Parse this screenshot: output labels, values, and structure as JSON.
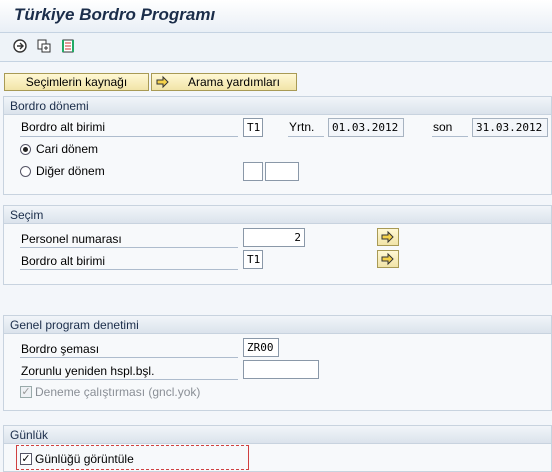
{
  "window": {
    "title": "Türkiye Bordro Programı"
  },
  "toolbar": {
    "icons": [
      "execute-icon",
      "copy-icon",
      "variant-icon"
    ]
  },
  "buttons": {
    "selection_source": "Seçimlerin kaynağı",
    "search_help": "Arama yardımları"
  },
  "payroll_period": {
    "header": "Bordro dönemi",
    "area_label": "Bordro alt birimi",
    "area_value": "T1",
    "from_label": "Yrtn.",
    "from_value": "01.03.2012",
    "to_label": "son",
    "to_value": "31.03.2012",
    "current_label": "Cari dönem",
    "other_label": "Diğer dönem",
    "current_selected": true
  },
  "selection": {
    "header": "Seçim",
    "personnel_label": "Personel numarası",
    "personnel_value": "2",
    "area_label": "Bordro alt birimi",
    "area_value": "T1"
  },
  "general_control": {
    "header": "Genel program denetimi",
    "schema_label": "Bordro şeması",
    "schema_value": "ZR00",
    "forced_label": "Zorunlu yeniden hspl.bşl.",
    "forced_value": "",
    "test_run_label": "Deneme çalıştırması (gncl.yok)",
    "test_run_checked": true
  },
  "log": {
    "header": "Günlük",
    "display_label": "Günlüğü görüntüle",
    "display_checked": true
  },
  "colors": {
    "accent": "#f1e4a8",
    "title": "#1b2d4a"
  }
}
